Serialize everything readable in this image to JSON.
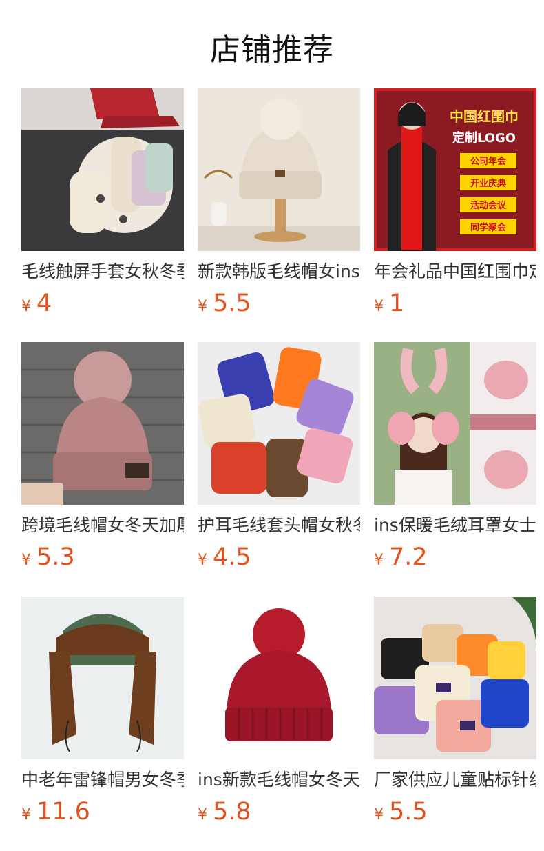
{
  "page": {
    "title": "店铺推荐"
  },
  "products": [
    {
      "name": "毛线触屏手套女秋冬季",
      "price": "4",
      "currency": "¥",
      "image": "knit-gloves-photo"
    },
    {
      "name": "新款韩版毛线帽女ins",
      "price": "5.5",
      "currency": "¥",
      "image": "beige-pom-beanie-photo"
    },
    {
      "name": "年会礼品中国红围巾定制",
      "price": "1",
      "currency": "¥",
      "image": "red-scarf-ad-photo",
      "image_text": {
        "headline": "中国红围巾",
        "sub": "定制LOGO",
        "tags": [
          "公司年会",
          "开业庆典",
          "活动会议",
          "同学聚会"
        ]
      }
    },
    {
      "name": "跨境毛线帽女冬天加厚",
      "price": "5.3",
      "currency": "¥",
      "image": "pink-cable-beanie-photo"
    },
    {
      "name": "护耳毛线套头帽女秋冬",
      "price": "4.5",
      "currency": "¥",
      "image": "colorful-beanies-photo"
    },
    {
      "name": "ins保暖毛绒耳罩女士",
      "price": "7.2",
      "currency": "¥",
      "image": "bunny-earmuffs-photo"
    },
    {
      "name": "中老年雷锋帽男女冬季",
      "price": "11.6",
      "currency": "¥",
      "image": "trapper-hat-photo"
    },
    {
      "name": "ins新款毛线帽女冬天加",
      "price": "5.8",
      "currency": "¥",
      "image": "red-pom-beanie-photo"
    },
    {
      "name": "厂家供应儿童贴标针织帽",
      "price": "5.5",
      "currency": "¥",
      "image": "kids-beanies-photo"
    }
  ]
}
